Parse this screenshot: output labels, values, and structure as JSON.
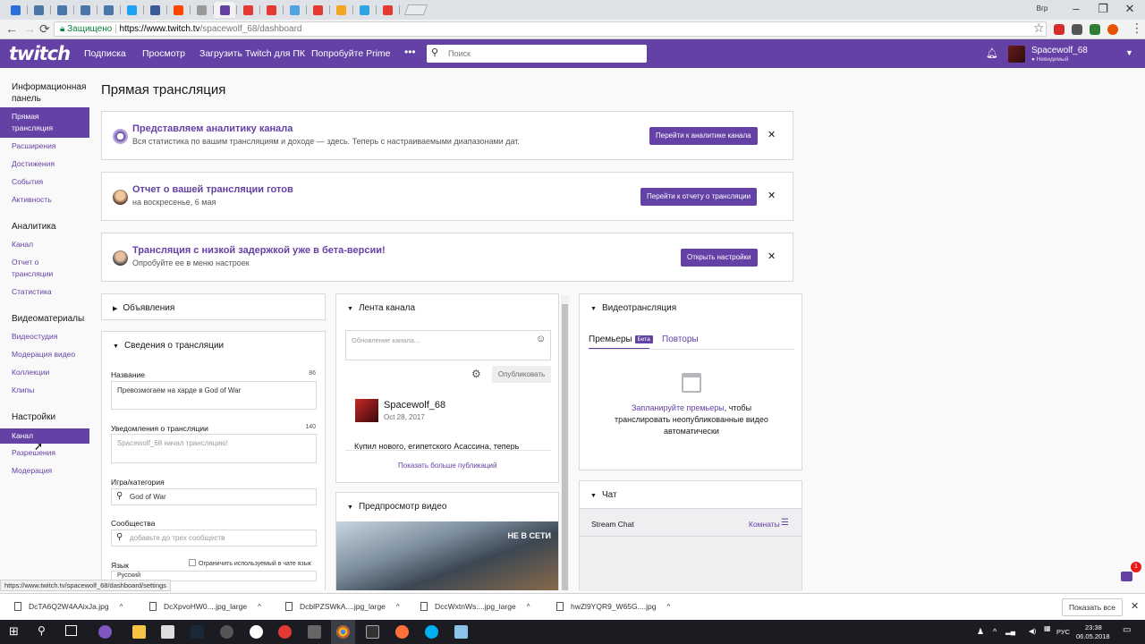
{
  "browser": {
    "tab_colors": [
      "#2a6fdb",
      "#4a76a8",
      "#4a76a8",
      "#4a76a8",
      "#4a76a8",
      "#1da1f2",
      "#3b5998",
      "#ff4500",
      "#999999",
      "#6441a4",
      "#e53935",
      "#e53935",
      "#4fa3e0",
      "#e53935",
      "#f4a622",
      "#2ca5e0",
      "#e53935"
    ],
    "window_user": "Вгр",
    "omnibox": {
      "secure_label": "Защищено",
      "url_host": "https://www.twitch.tv",
      "url_path": "/spacewolf_68/dashboard"
    },
    "status_url": "https://www.twitch.tv/spacewolf_68/dashboard/settings"
  },
  "topnav": {
    "logo": "twitch",
    "links": [
      "Подписка",
      "Просмотр",
      "Загрузить Twitch для ПК",
      "Попробуйте Prime"
    ],
    "more": "•••",
    "search_placeholder": "Поиск",
    "username": "Spacewolf_68",
    "user_status": "● Невидимый",
    "brand_color": "#6441a4"
  },
  "sidebar": {
    "dashboard_head": "Информационная панель",
    "items_dashboard": [
      "Прямая трансляция",
      "Расширения",
      "Достижения",
      "События",
      "Активность"
    ],
    "analytics_head": "Аналитика",
    "items_analytics": [
      "Канал",
      "Отчет о трансляции",
      "Статистика"
    ],
    "video_head": "Видеоматериалы",
    "items_video": [
      "Видеостудия",
      "Модерация видео",
      "Коллекции",
      "Клипы"
    ],
    "settings_head": "Настройки",
    "items_settings": [
      "Канал",
      "Разрешения",
      "Модерация"
    ]
  },
  "main": {
    "page_title": "Прямая трансляция",
    "banners": [
      {
        "title": "Представляем аналитику канала",
        "sub": "Вся статистика по вашим трансляциям и доходе — здесь. Теперь с настраиваемыми диапазонами дат.",
        "button": "Перейти к аналитике канала"
      },
      {
        "title": "Отчет о вашей трансляции готов",
        "sub": "на воскресенье, 6 мая",
        "button": "Перейти к отчету о трансляции"
      },
      {
        "title": "Трансляция с низкой задержкой уже в бета-версии!",
        "sub": "Опробуйте ее в меню настроек",
        "button": "Открыть настройки"
      }
    ],
    "close_glyph": "✕",
    "announcements": "Объявления",
    "stream_info": {
      "head": "Сведения о трансляции",
      "title_label": "Название",
      "title_count": "86",
      "title_value": "Превозмогаем на харде в God of War",
      "notify_label": "Уведомления о трансляции",
      "notify_count": "140",
      "notify_placeholder": "Spacewolf_68 начал трансляцию!",
      "game_label": "Игра/категория",
      "game_value": "God of War",
      "communities_label": "Сообщества",
      "communities_placeholder": "добавьте до трех сообществ",
      "language_label": "Язык",
      "language_checkbox": "Ограничить используемый в чате язык",
      "language_value": "Русский"
    },
    "feed": {
      "head": "Лента канала",
      "placeholder": "Обновление канала...",
      "publish": "Опубликовать",
      "author": "Spacewolf_68",
      "date": "Oct 28, 2017",
      "post_text": "Купил нового, египетского Асассина, теперь",
      "more": "Показать больше публикаций"
    },
    "preview": {
      "head": "Предпросмотр видео",
      "offline": "НЕ В СЕТИ"
    },
    "video": {
      "head": "Видеотрансляция",
      "tab_premieres": "Премьеры",
      "beta": "Бета",
      "tab_reruns": "Повторы",
      "schedule_link": "Запланируйте премьеры",
      "schedule_text": ", чтобы транслировать неопубликованные видео автоматически"
    },
    "chat": {
      "head": "Чат",
      "stream_chat": "Stream Chat",
      "rooms": "Комнаты",
      "badge": "1"
    }
  },
  "downloads": {
    "files": [
      "DcTA6Q2W4AAixJa.jpg",
      "DcXpvoHW0....jpg_large",
      "DcblPZSWkA....jpg_large",
      "DccWxtnWs....jpg_large",
      "hwZl9YQR9_W65G....jpg"
    ],
    "show_all": "Показать все"
  },
  "taskbar": {
    "lang": "РУС",
    "time": "23:38",
    "date": "06.05.2018"
  }
}
